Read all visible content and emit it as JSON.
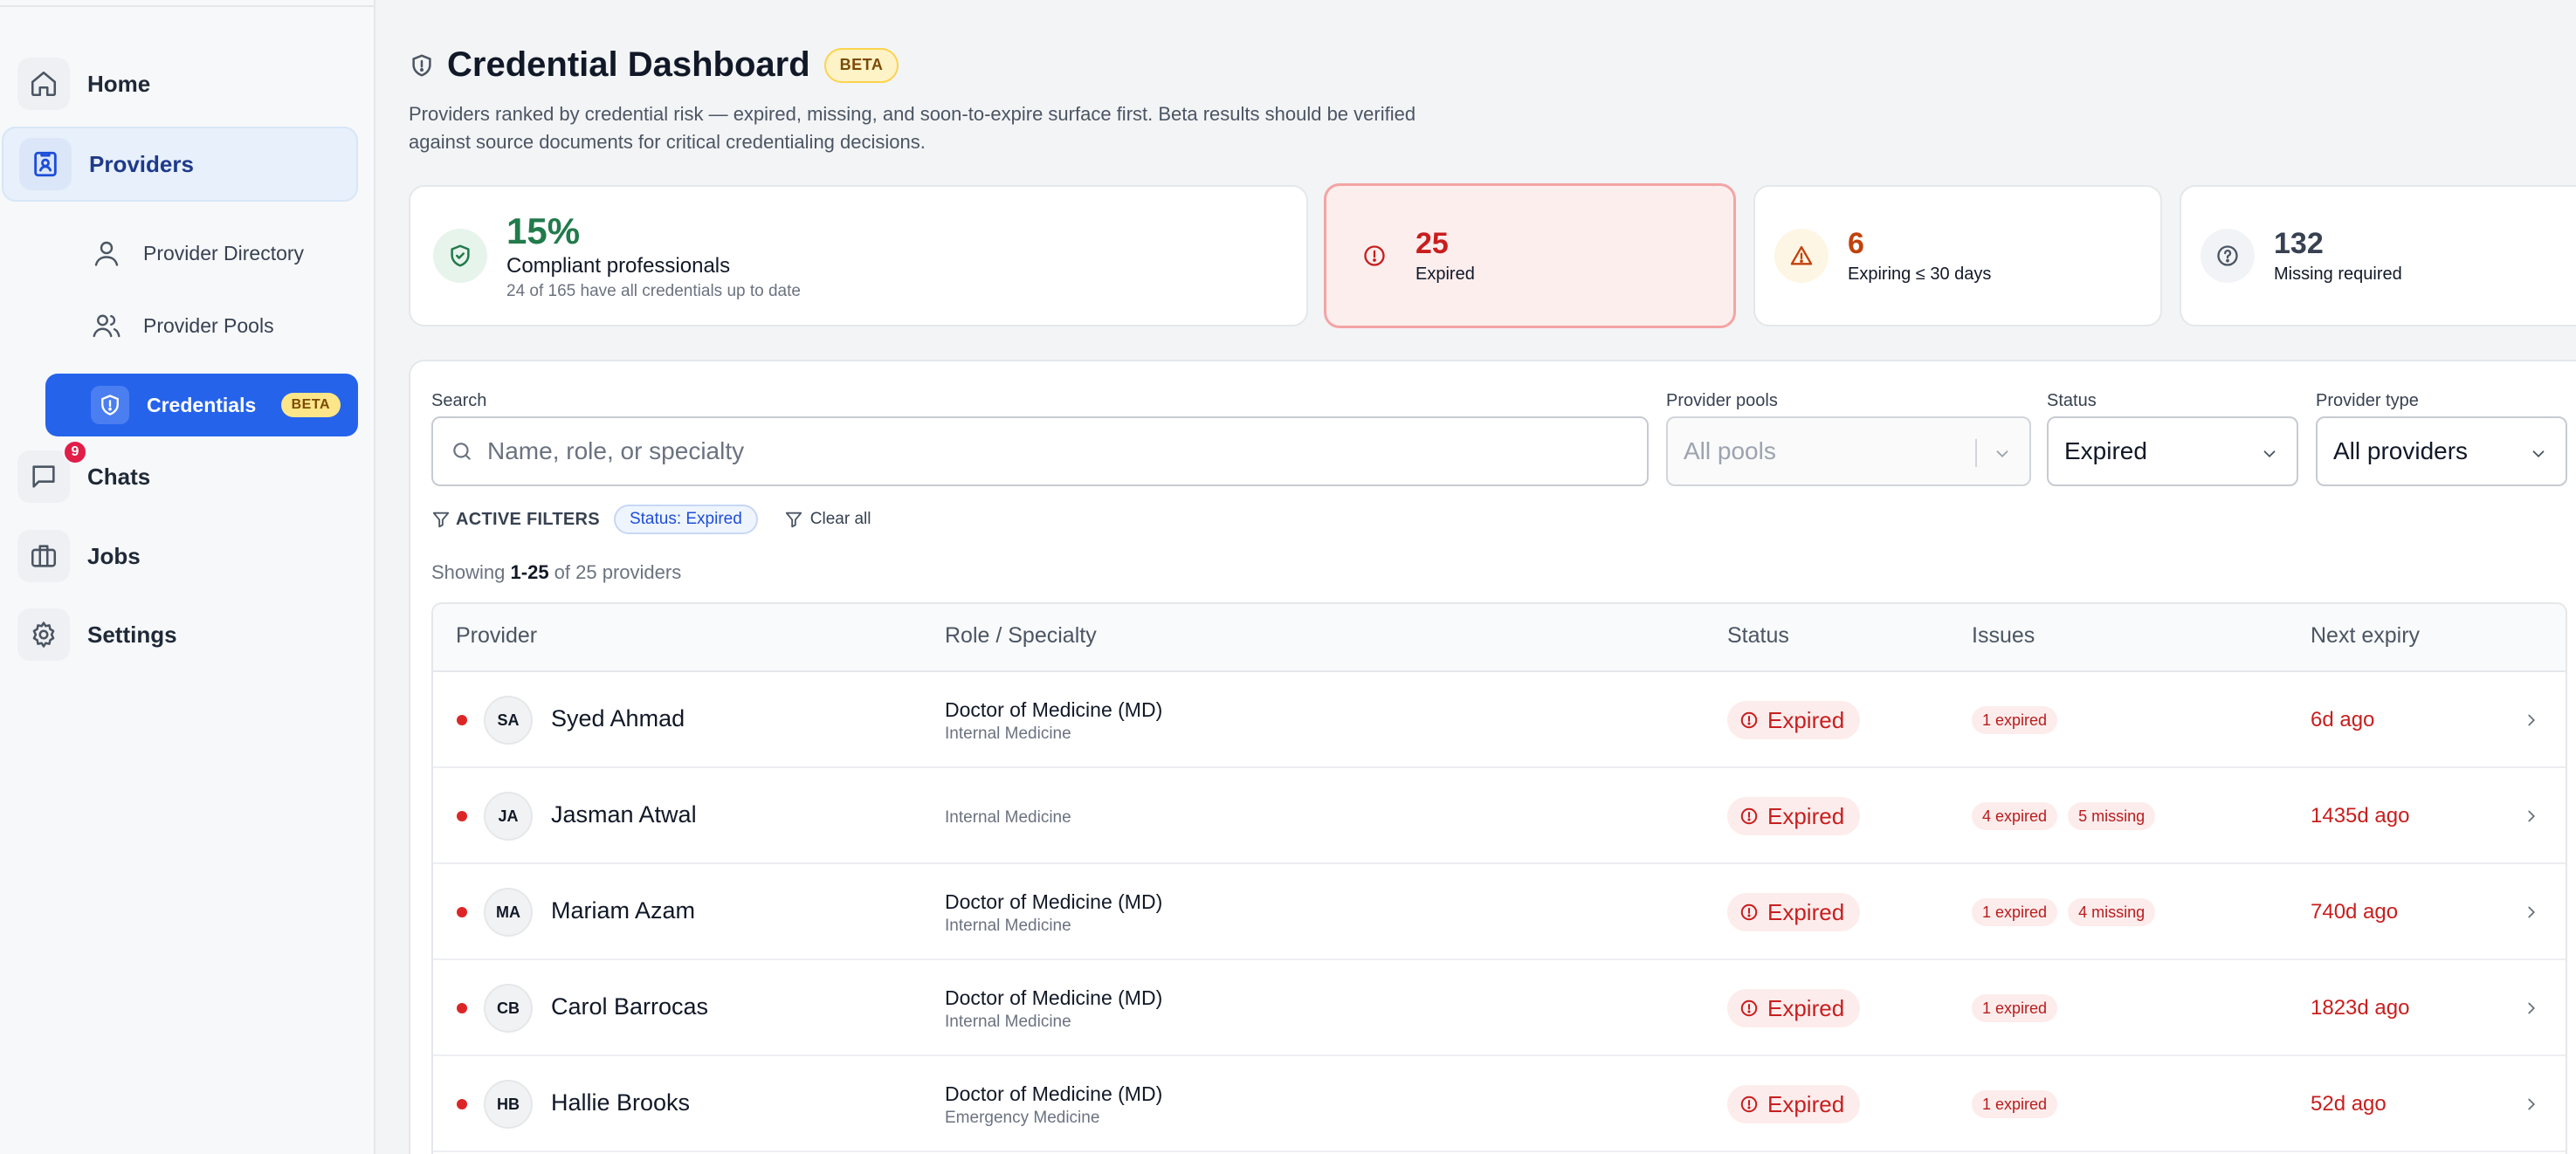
{
  "sidebar": {
    "nav": {
      "home": "Home",
      "providers": "Providers",
      "chats": "Chats",
      "chats_badge": "9",
      "jobs": "Jobs",
      "settings": "Settings"
    },
    "sub": {
      "directory": "Provider Directory",
      "pools": "Provider Pools",
      "credentials": "Credentials",
      "credentials_badge": "BETA"
    }
  },
  "header": {
    "title": "Credential Dashboard",
    "badge": "BETA",
    "description": "Providers ranked by credential risk — expired, missing, and soon-to-expire surface first. Beta results should be verified against source documents for critical credentialing decisions."
  },
  "stats": {
    "compliant": {
      "value": "15%",
      "title": "Compliant professionals",
      "sub": "24 of 165 have all credentials up to date"
    },
    "expired": {
      "value": "25",
      "label": "Expired"
    },
    "expiring": {
      "value": "6",
      "label": "Expiring ≤ 30 days"
    },
    "missing": {
      "value": "132",
      "label": "Missing required"
    }
  },
  "filters": {
    "search_label": "Search",
    "search_placeholder": "Name, role, or specialty",
    "pools_label": "Provider pools",
    "pools_placeholder": "All pools",
    "status_label": "Status",
    "status_value": "Expired",
    "type_label": "Provider type",
    "type_value": "All providers",
    "active_label": "ACTIVE FILTERS",
    "active_chip": "Status: Expired",
    "clear_all": "Clear all"
  },
  "showing": {
    "prefix": "Showing ",
    "range": "1-25",
    "suffix": " of 25 providers"
  },
  "table": {
    "headers": {
      "provider": "Provider",
      "role": "Role / Specialty",
      "status": "Status",
      "issues": "Issues",
      "expiry": "Next expiry"
    },
    "rows": [
      {
        "initials": "SA",
        "name": "Syed Ahmad",
        "role": "Doctor of Medicine (MD)",
        "specialty": "Internal Medicine",
        "status": "Expired",
        "issue1": "1 expired",
        "issue2": "",
        "expiry": "6d ago"
      },
      {
        "initials": "JA",
        "name": "Jasman Atwal",
        "role": "",
        "specialty": "Internal Medicine",
        "status": "Expired",
        "issue1": "4 expired",
        "issue2": "5 missing",
        "expiry": "1435d ago"
      },
      {
        "initials": "MA",
        "name": "Mariam Azam",
        "role": "Doctor of Medicine (MD)",
        "specialty": "Internal Medicine",
        "status": "Expired",
        "issue1": "1 expired",
        "issue2": "4 missing",
        "expiry": "740d ago"
      },
      {
        "initials": "CB",
        "name": "Carol Barrocas",
        "role": "Doctor of Medicine (MD)",
        "specialty": "Internal Medicine",
        "status": "Expired",
        "issue1": "1 expired",
        "issue2": "",
        "expiry": "1823d ago"
      },
      {
        "initials": "HB",
        "name": "Hallie Brooks",
        "role": "Doctor of Medicine (MD)",
        "specialty": "Emergency Medicine",
        "status": "Expired",
        "issue1": "1 expired",
        "issue2": "",
        "expiry": "52d ago"
      }
    ]
  },
  "icons": {
    "home": "home-icon",
    "providers": "id-badge-icon",
    "chats": "chat-bubble-icon",
    "jobs": "briefcase-icon",
    "settings": "gear-icon",
    "search": "search-icon",
    "shield": "shield-icon",
    "alert": "alert-circle-icon",
    "warning": "warning-triangle-icon",
    "question": "question-circle-icon",
    "chevron": "chevron-right-icon"
  },
  "colors": {
    "accent": "#2563eb",
    "danger": "#c81e1e",
    "success": "#217a4b",
    "warning": "#c2410c"
  }
}
